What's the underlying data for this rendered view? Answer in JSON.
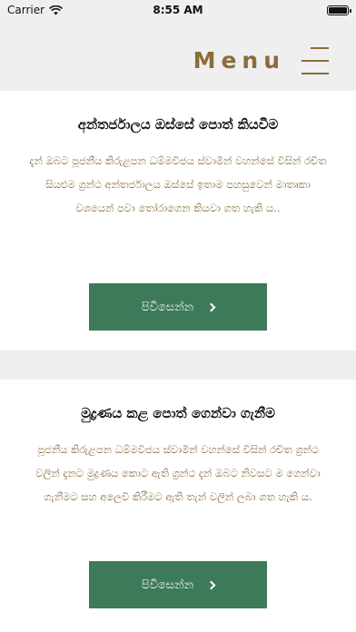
{
  "status_bar": {
    "carrier": "Carrier",
    "time": "8:55 AM"
  },
  "header": {
    "menu_label": "Menu"
  },
  "cards": [
    {
      "title": "අන්තර්ජාලය ඔස්සේ පොත් කියවීම",
      "body": "දැන් ඔබට පූජනීය කිරුළපන ධම්මවිජය ස්වාමීන් වහන්සේ විසින් රචිත සියළුම ග්‍රන්ථ අන්තර්ජාලය ඔස්සේ ඉතාම පහසුවෙන් මාතෘකා වශයෙන් පවා තෝරාගෙන කියවා ගත හැකි ය..",
      "button_label": "පිවිසෙන්න"
    },
    {
      "title": "මුද්‍රණය කළ පොත් ගෙන්වා ගැනීම",
      "body": "පූජනීය කිරුළපන ධම්මවිජය ස්වාමීන් වහන්සේ විසින් රචිත ග්‍රන්ථ වලින් දැනට මුද්‍රණය කොට ඇති ග්‍රන්ථ දැන් ඔබට නිවසට ම ගෙන්වා ගැනීමට සහ අලෙවි කිරීමට ඇති තැන් වලින් ලබා ගත හැකි ය.",
      "button_label": "පිවිසෙන්න"
    }
  ],
  "colors": {
    "accent": "#8a6d3b",
    "button": "#3d7a5a",
    "background": "#efefef"
  }
}
